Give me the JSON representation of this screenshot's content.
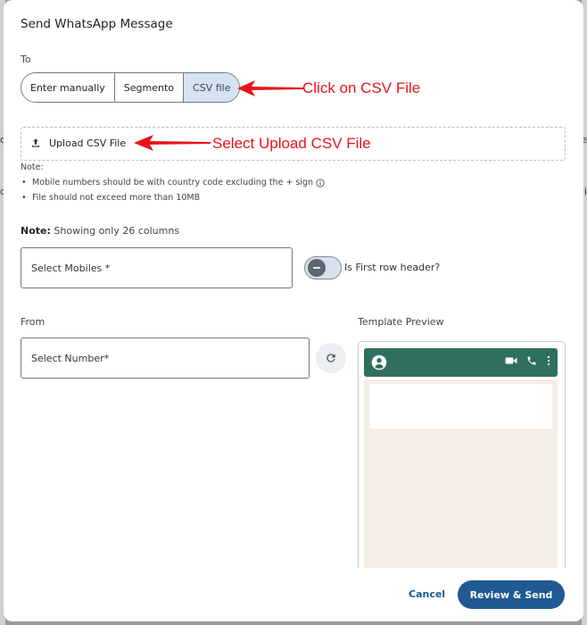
{
  "dialog": {
    "title": "Send WhatsApp Message"
  },
  "to": {
    "label": "To",
    "options": [
      "Enter manually",
      "Segmento",
      "CSV file"
    ],
    "selected": "CSV file"
  },
  "upload": {
    "label": "Upload CSV File"
  },
  "notes": {
    "heading": "Note:",
    "items": [
      "Mobile numbers should be with country code excluding the + sign",
      "File should not exceed more than 10MB"
    ]
  },
  "columns_note": {
    "bold": "Note:",
    "text": " Showing only 26 columns"
  },
  "mobiles_field": {
    "placeholder": "Select Mobiles *"
  },
  "toggle": {
    "label": "Is First row header?",
    "checked": false
  },
  "from": {
    "label": "From",
    "placeholder": "Select Number*"
  },
  "template_preview": {
    "label": "Template Preview"
  },
  "footer": {
    "cancel": "Cancel",
    "submit": "Review & Send"
  },
  "annotations": {
    "csv_hint": "Click on CSV File",
    "upload_hint": "Select Upload CSV File"
  },
  "colors": {
    "accent": "#1f5a92",
    "whatsapp_header": "#2f6f5e",
    "chat_bg": "#f5eee6",
    "annotation": "#e8141a",
    "selected_segment": "#d5e2f2"
  },
  "icons": [
    "upload-icon",
    "info-icon",
    "refresh-icon",
    "account-circle-icon",
    "video-call-icon",
    "phone-icon",
    "more-vert-icon",
    "arrow-icon"
  ]
}
